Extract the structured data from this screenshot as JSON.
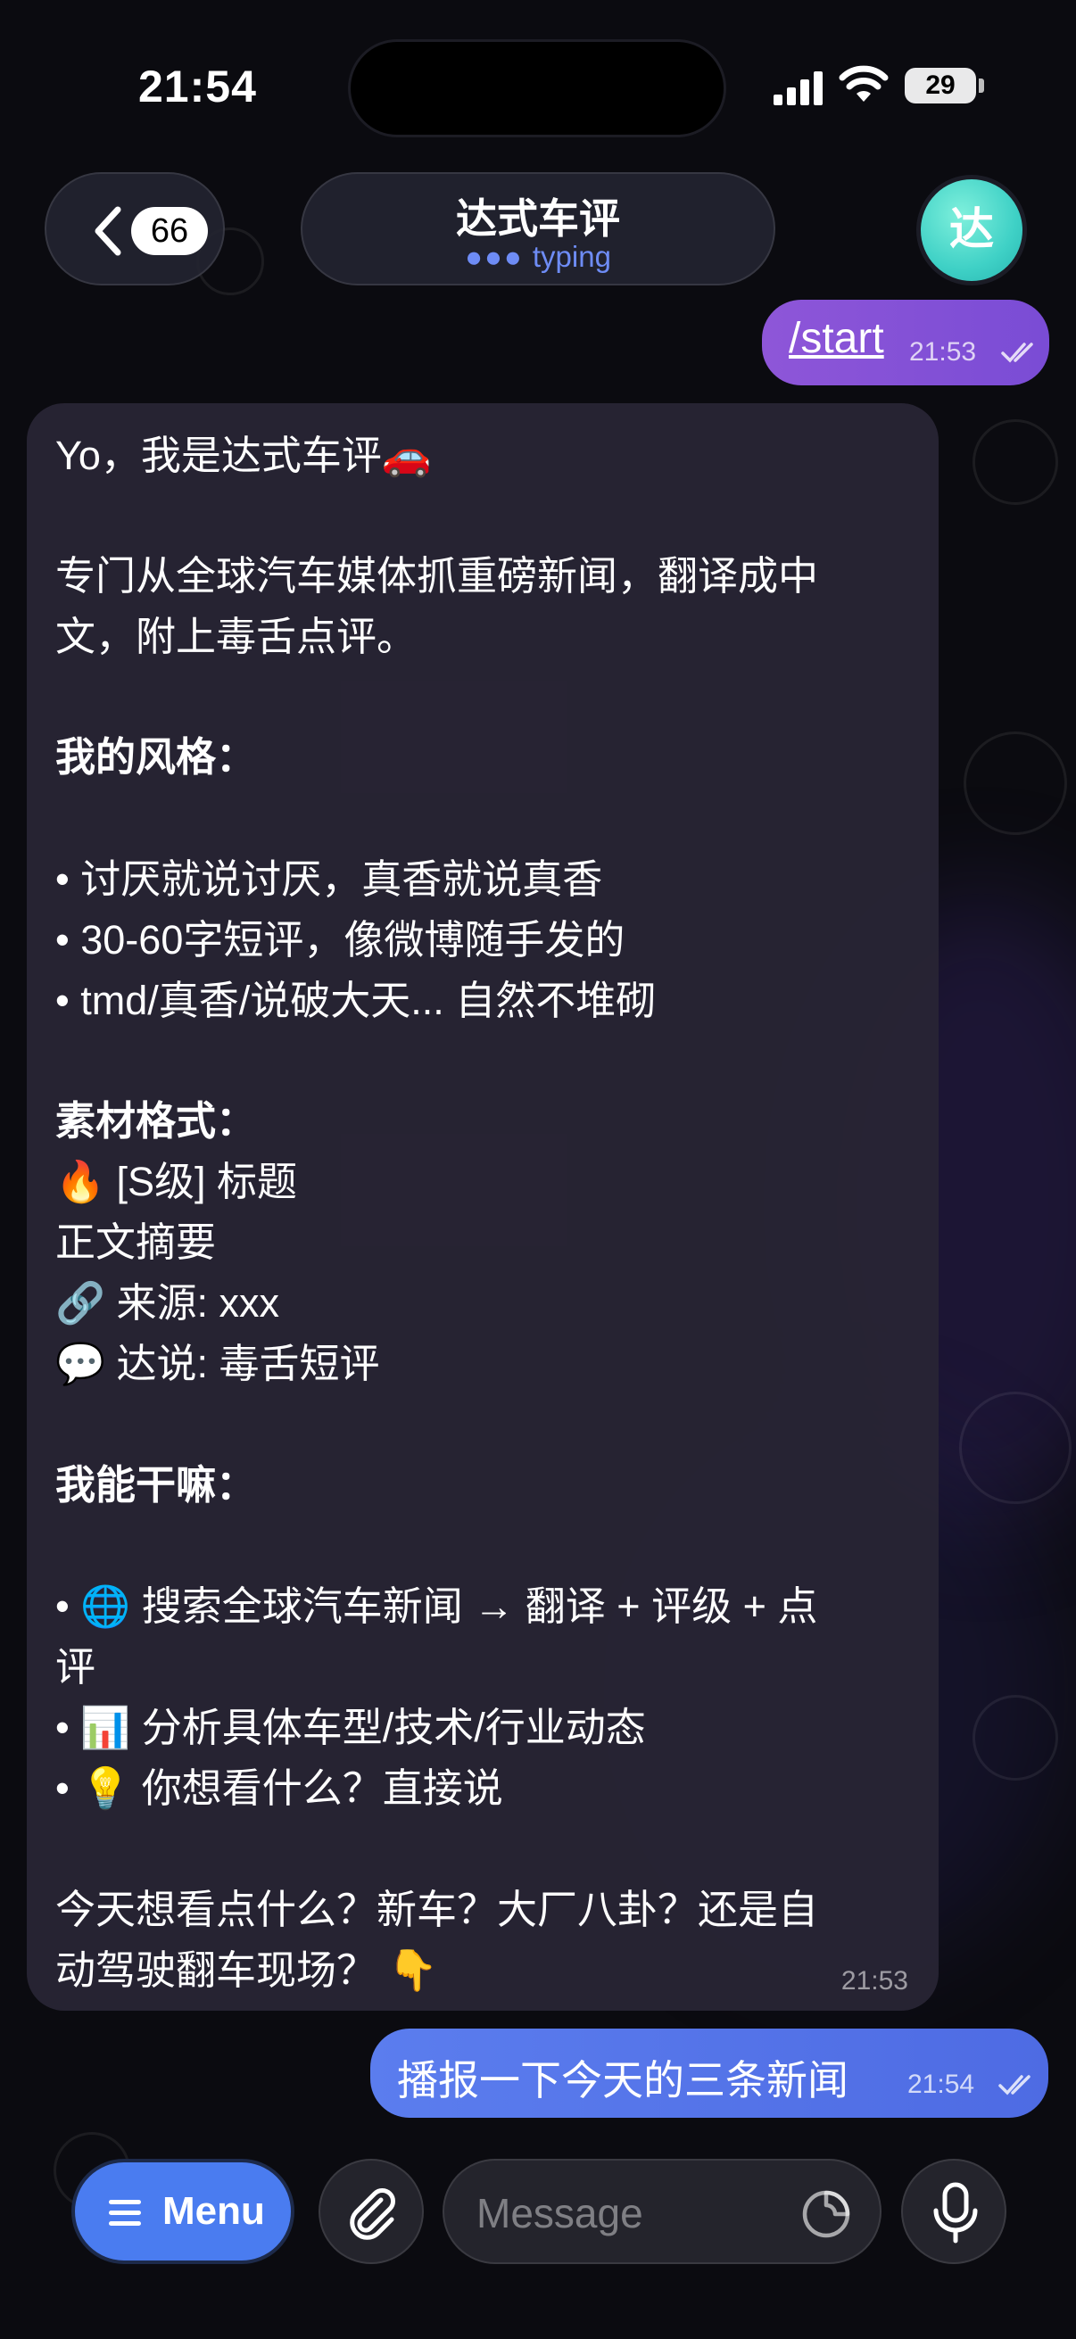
{
  "status_bar": {
    "time": "21:54",
    "battery": "29"
  },
  "header": {
    "back_count": "66",
    "title": "达式车评",
    "status": "typing",
    "avatar_letter": "达"
  },
  "messages": {
    "out1": {
      "text": "/start",
      "time": "21:53"
    },
    "in1": {
      "lines": [
        "Yo，我是达式车评🚗",
        "专门从全球汽车媒体抓重磅新闻，翻译成中",
        "文，附上毒舌点评。",
        "我的风格：",
        "• 讨厌就说讨厌，真香就说真香",
        "• 30-60字短评，像微博随手发的",
        "• tmd/真香/说破大天... 自然不堆砌",
        "素材格式：",
        "🔥 [S级] 标题",
        "正文摘要",
        "🔗 来源: xxx",
        "💬 达说: 毒舌短评",
        "我能干嘛：",
        "• 🌐 搜索全球汽车新闻 → 翻译 + 评级 + 点",
        "评",
        "• 📊 分析具体车型/技术/行业动态",
        "• 💡 你想看什么？直接说",
        "今天想看点什么？新车？大厂八卦？还是自",
        "动驾驶翻车现场？ 👇"
      ],
      "time": "21:53"
    },
    "out2": {
      "text": "播报一下今天的三条新闻",
      "time": "21:54"
    }
  },
  "input_bar": {
    "menu_label": "Menu",
    "placeholder": "Message"
  }
}
